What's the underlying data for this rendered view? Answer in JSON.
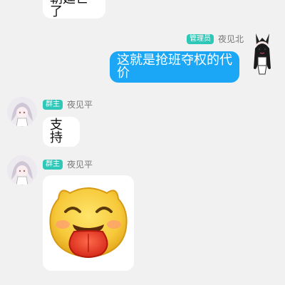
{
  "messages": [
    {
      "id": "m0",
      "text": "朝廷亡了"
    },
    {
      "id": "m1",
      "sender": "夜见北",
      "role_badge": "管理员",
      "text": "这就是抢班夺权的代价"
    },
    {
      "id": "m2",
      "sender": "夜见平",
      "role_badge": "群主",
      "text": "支持"
    },
    {
      "id": "m3",
      "sender": "夜见平",
      "role_badge": "群主",
      "sticker": "tongue-out-emoji-sticker"
    }
  ],
  "colors": {
    "background": "#f1f1f1",
    "self_bubble": "#1ba7f6",
    "other_bubble": "#ffffff",
    "badge": "#2fc7b8"
  }
}
